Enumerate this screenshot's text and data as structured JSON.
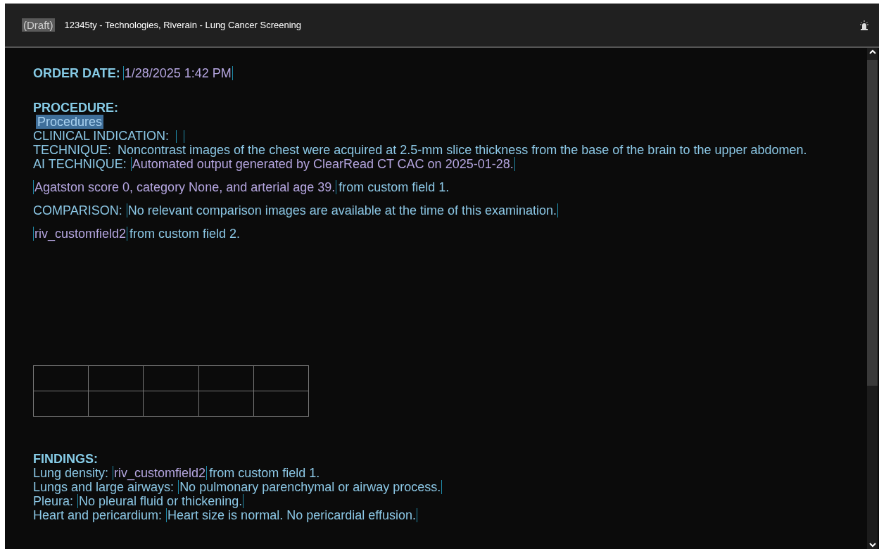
{
  "header": {
    "badge": "(Draft)",
    "title": "12345ty - Technologies, Riverain - Lung Cancer Screening"
  },
  "blocks": [
    {
      "kind": "para",
      "lines": [
        [
          {
            "kind": "heading",
            "text": "ORDER DATE:"
          },
          {
            "kind": "field",
            "color": "#b5a6e0",
            "text": "1/28/2025 1:42 PM"
          }
        ]
      ]
    },
    {
      "kind": "para",
      "lines": [
        [
          {
            "kind": "heading",
            "text": "PROCEDURE:"
          }
        ],
        [
          {
            "kind": "selection",
            "text": "Procedures"
          }
        ],
        [
          {
            "kind": "label",
            "text": "CLINICAL INDICATION:"
          },
          {
            "kind": "empty-field"
          }
        ],
        [
          {
            "kind": "label",
            "text": "TECHNIQUE:"
          },
          {
            "kind": "text",
            "text": "Noncontrast images of the chest were acquired at 2.5-mm slice thickness from the base of the brain to the upper abdomen."
          }
        ],
        [
          {
            "kind": "label",
            "text": "AI TECHNIQUE:"
          },
          {
            "kind": "field",
            "color": "#b5a6e0",
            "text": "Automated output generated by ClearRead CT CAC on 2025-01-28."
          }
        ]
      ]
    },
    {
      "kind": "para",
      "lines": [
        [
          {
            "kind": "field",
            "color": "#b5a6e0",
            "text": "Agatston score 0, category None, and arterial age 39."
          },
          {
            "kind": "text",
            "text": "from custom field 1."
          }
        ]
      ]
    },
    {
      "kind": "para",
      "lines": [
        [
          {
            "kind": "label",
            "text": "COMPARISON:"
          },
          {
            "kind": "field",
            "color": "#8cc8e6",
            "text": "No relevant comparison images are available at the time of this examination."
          }
        ]
      ]
    },
    {
      "kind": "para",
      "lines": [
        [
          {
            "kind": "field",
            "color": "#b5a6e0",
            "text": "riv_customfield2"
          },
          {
            "kind": "text",
            "text": "from custom field 2."
          }
        ]
      ]
    },
    {
      "kind": "table"
    },
    {
      "kind": "para",
      "lines": [
        [
          {
            "kind": "heading",
            "text": "FINDINGS:"
          }
        ],
        [
          {
            "kind": "label",
            "text": "Lung density:"
          },
          {
            "kind": "field",
            "color": "#b5a6e0",
            "text": "riv_customfield2"
          },
          {
            "kind": "text",
            "text": "from custom field 1."
          }
        ],
        [
          {
            "kind": "label",
            "text": "Lungs and large airways:"
          },
          {
            "kind": "field",
            "color": "#8cc8e6",
            "text": "No pulmonary parenchymal or airway process."
          }
        ],
        [
          {
            "kind": "label",
            "text": "Pleura:"
          },
          {
            "kind": "field",
            "color": "#8cc8e6",
            "text": "No pleural fluid or thickening."
          }
        ],
        [
          {
            "kind": "label",
            "text": "Heart and pericardium:"
          },
          {
            "kind": "field",
            "color": "#8cc8e6",
            "text": "Heart size is normal. No pericardial effusion."
          }
        ]
      ]
    }
  ]
}
